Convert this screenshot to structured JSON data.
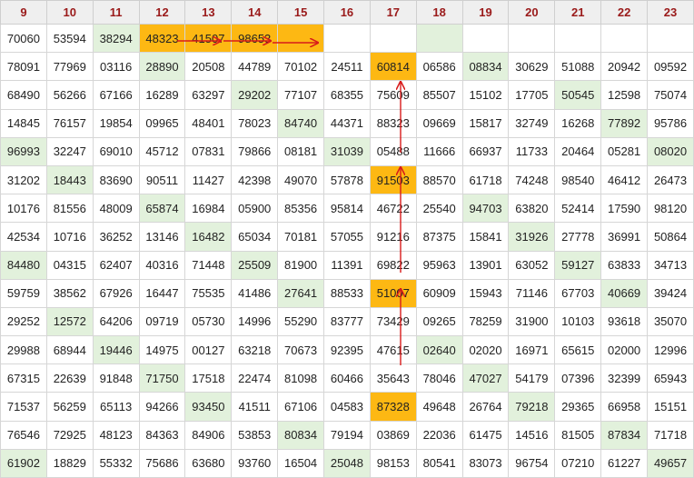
{
  "columns": [
    "9",
    "10",
    "11",
    "12",
    "13",
    "14",
    "15",
    "16",
    "17",
    "18",
    "19",
    "20",
    "21",
    "22",
    "23"
  ],
  "rows": [
    [
      "70060",
      "53594",
      "38294",
      "48323",
      "41507",
      "98653",
      "",
      "",
      "",
      "",
      "",
      "",
      "",
      "",
      ""
    ],
    [
      "78091",
      "77969",
      "03116",
      "28890",
      "20508",
      "44789",
      "70102",
      "24511",
      "60814",
      "06586",
      "08834",
      "30629",
      "51088",
      "20942",
      "09592"
    ],
    [
      "68490",
      "56266",
      "67166",
      "16289",
      "63297",
      "29202",
      "77107",
      "68355",
      "75609",
      "85507",
      "15102",
      "17705",
      "50545",
      "12598",
      "75074"
    ],
    [
      "14845",
      "76157",
      "19854",
      "09965",
      "48401",
      "78023",
      "84740",
      "44371",
      "88323",
      "09669",
      "15817",
      "32749",
      "16268",
      "77892",
      "95786"
    ],
    [
      "96993",
      "32247",
      "69010",
      "45712",
      "07831",
      "79866",
      "08181",
      "31039",
      "05488",
      "11666",
      "66937",
      "11733",
      "20464",
      "05281",
      "08020"
    ],
    [
      "31202",
      "18443",
      "83690",
      "90511",
      "11427",
      "42398",
      "49070",
      "57878",
      "91503",
      "88570",
      "61718",
      "74248",
      "98540",
      "46412",
      "26473"
    ],
    [
      "10176",
      "81556",
      "48009",
      "65874",
      "16984",
      "05900",
      "85356",
      "95814",
      "46722",
      "25540",
      "94703",
      "63820",
      "52414",
      "17590",
      "98120"
    ],
    [
      "42534",
      "10716",
      "36252",
      "13146",
      "16482",
      "65034",
      "70181",
      "57055",
      "91216",
      "87375",
      "15841",
      "31926",
      "27778",
      "36991",
      "50864"
    ],
    [
      "84480",
      "04315",
      "62407",
      "40316",
      "71448",
      "25509",
      "81900",
      "11391",
      "69822",
      "95963",
      "13901",
      "63052",
      "59127",
      "63833",
      "34713"
    ],
    [
      "59759",
      "38562",
      "67926",
      "16447",
      "75535",
      "41486",
      "27641",
      "88533",
      "51007",
      "60909",
      "15943",
      "71146",
      "67703",
      "40669",
      "39424"
    ],
    [
      "29252",
      "12572",
      "64206",
      "09719",
      "05730",
      "14996",
      "55290",
      "83777",
      "73429",
      "09265",
      "78259",
      "31900",
      "10103",
      "93618",
      "35070"
    ],
    [
      "29988",
      "68944",
      "19446",
      "14975",
      "00127",
      "63218",
      "70673",
      "92395",
      "47615",
      "02640",
      "02020",
      "16971",
      "65615",
      "02000",
      "12996"
    ],
    [
      "67315",
      "22639",
      "91848",
      "71750",
      "17518",
      "22474",
      "81098",
      "60466",
      "35643",
      "78046",
      "47027",
      "54179",
      "07396",
      "32399",
      "65943"
    ],
    [
      "71537",
      "56259",
      "65113",
      "94266",
      "93450",
      "41511",
      "67106",
      "04583",
      "87328",
      "49648",
      "26764",
      "79218",
      "29365",
      "66958",
      "15151"
    ],
    [
      "76546",
      "72925",
      "48123",
      "84363",
      "84906",
      "53853",
      "80834",
      "79194",
      "03869",
      "22036",
      "61475",
      "14516",
      "81505",
      "87834",
      "71718"
    ],
    [
      "61902",
      "18829",
      "55332",
      "75686",
      "63680",
      "93760",
      "16504",
      "25048",
      "98153",
      "80541",
      "83073",
      "96754",
      "07210",
      "61227",
      "49657"
    ]
  ],
  "cell_state": [
    [
      "n",
      "n",
      "g",
      "o",
      "o",
      "o",
      "o",
      "e",
      "e",
      "g",
      "e",
      "e",
      "e",
      "e",
      "e"
    ],
    [
      "n",
      "n",
      "n",
      "g",
      "n",
      "n",
      "n",
      "n",
      "o",
      "n",
      "g",
      "n",
      "n",
      "n",
      "n"
    ],
    [
      "n",
      "n",
      "n",
      "n",
      "n",
      "g",
      "n",
      "n",
      "n",
      "n",
      "n",
      "n",
      "g",
      "n",
      "n"
    ],
    [
      "n",
      "n",
      "n",
      "n",
      "n",
      "n",
      "g",
      "n",
      "n",
      "n",
      "n",
      "n",
      "n",
      "g",
      "n"
    ],
    [
      "g",
      "n",
      "n",
      "n",
      "n",
      "n",
      "n",
      "g",
      "n",
      "n",
      "n",
      "n",
      "n",
      "n",
      "g"
    ],
    [
      "n",
      "g",
      "n",
      "n",
      "n",
      "n",
      "n",
      "n",
      "o",
      "n",
      "n",
      "n",
      "n",
      "n",
      "n"
    ],
    [
      "n",
      "n",
      "n",
      "g",
      "n",
      "n",
      "n",
      "n",
      "n",
      "n",
      "g",
      "n",
      "n",
      "n",
      "n"
    ],
    [
      "n",
      "n",
      "n",
      "n",
      "g",
      "n",
      "n",
      "n",
      "n",
      "n",
      "n",
      "g",
      "n",
      "n",
      "n"
    ],
    [
      "g",
      "n",
      "n",
      "n",
      "n",
      "g",
      "n",
      "n",
      "n",
      "n",
      "n",
      "n",
      "g",
      "n",
      "n"
    ],
    [
      "n",
      "n",
      "n",
      "n",
      "n",
      "n",
      "g",
      "n",
      "o",
      "n",
      "n",
      "n",
      "n",
      "g",
      "n"
    ],
    [
      "n",
      "g",
      "n",
      "n",
      "n",
      "n",
      "n",
      "n",
      "n",
      "n",
      "n",
      "n",
      "n",
      "n",
      "n"
    ],
    [
      "n",
      "n",
      "g",
      "n",
      "n",
      "n",
      "n",
      "n",
      "n",
      "g",
      "n",
      "n",
      "n",
      "n",
      "n"
    ],
    [
      "n",
      "n",
      "n",
      "g",
      "n",
      "n",
      "n",
      "n",
      "n",
      "n",
      "g",
      "n",
      "n",
      "n",
      "n"
    ],
    [
      "n",
      "n",
      "n",
      "n",
      "g",
      "n",
      "n",
      "n",
      "o",
      "n",
      "n",
      "g",
      "n",
      "n",
      "n"
    ],
    [
      "n",
      "n",
      "n",
      "n",
      "n",
      "n",
      "g",
      "n",
      "n",
      "n",
      "n",
      "n",
      "n",
      "g",
      "n"
    ],
    [
      "g",
      "n",
      "n",
      "n",
      "n",
      "n",
      "n",
      "g",
      "n",
      "n",
      "n",
      "n",
      "n",
      "n",
      "g"
    ]
  ],
  "colors": {
    "highlight_orange": "#fdb813",
    "highlight_green": "#e2f1dc",
    "header_text": "#9a1a1a",
    "arrow_red": "#d81b1b"
  }
}
